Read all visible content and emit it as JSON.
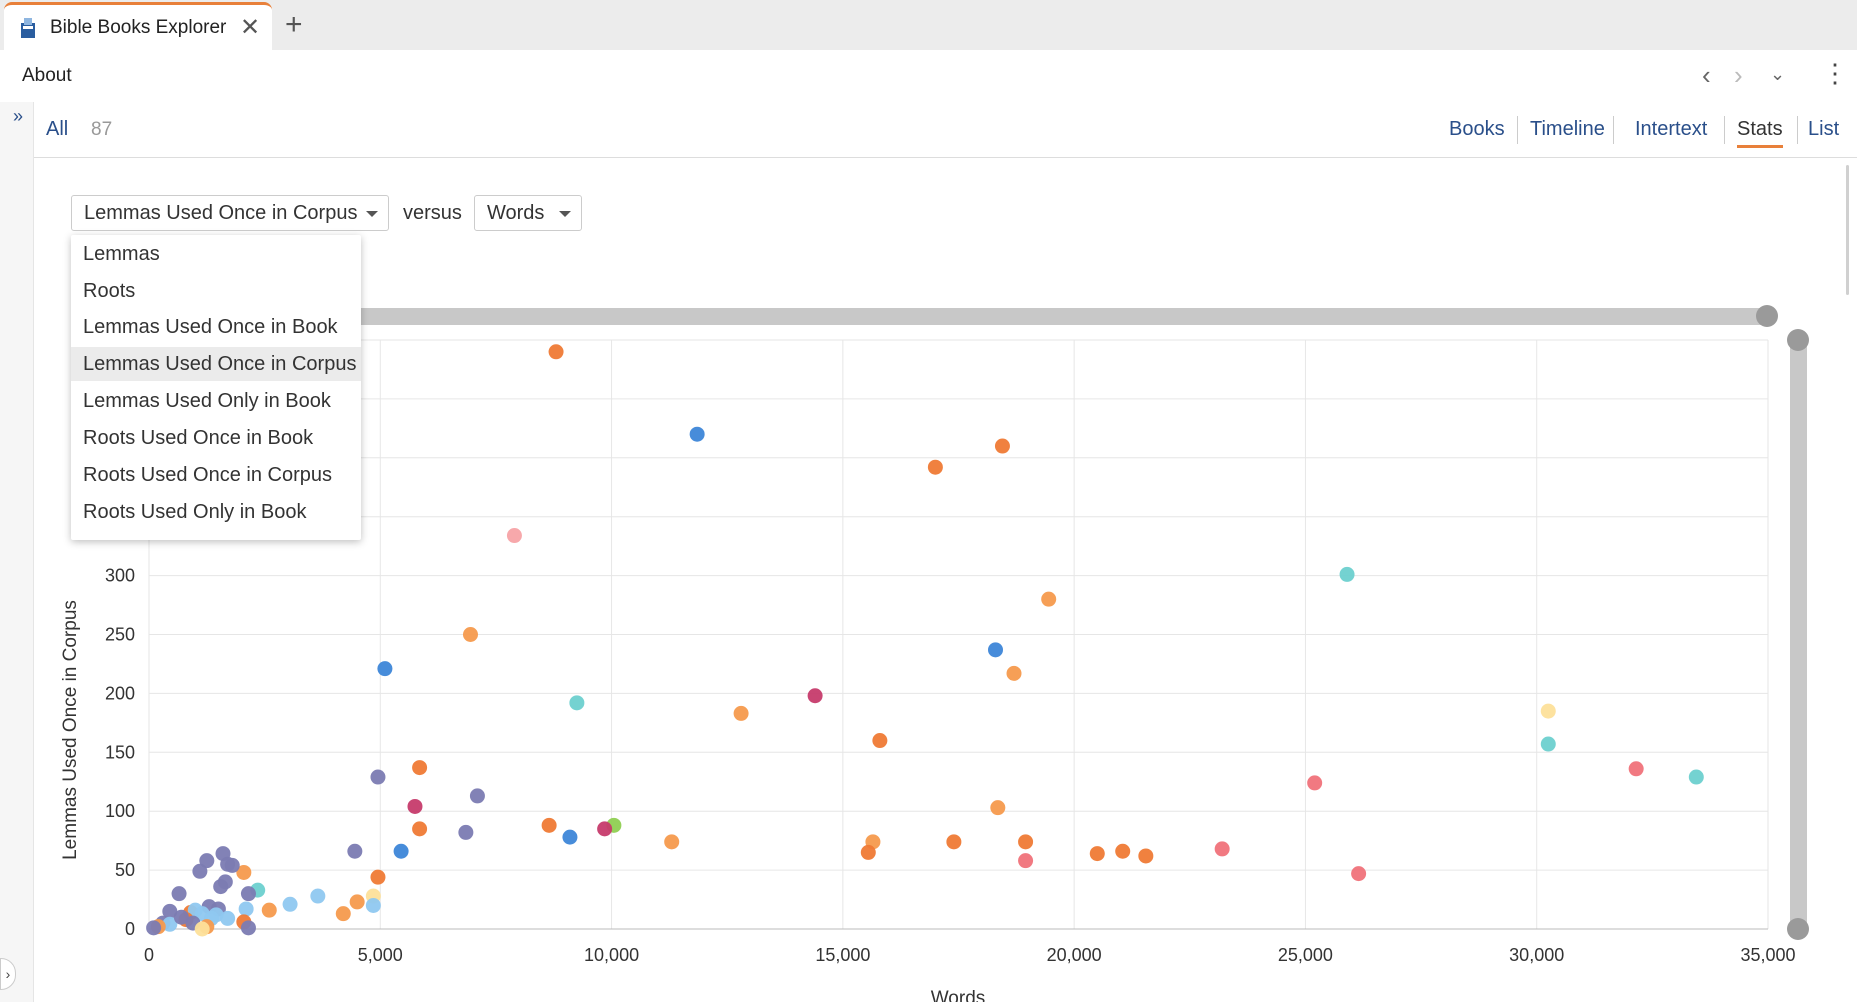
{
  "app": {
    "tab_title": "Bible Books Explorer",
    "tab_close": "✕",
    "new_tab": "+"
  },
  "toolbar": {
    "about_label": "About",
    "back": "‹",
    "forward": "›",
    "menu_down": "⌄",
    "more": "⋮"
  },
  "rail": {
    "expand": "»",
    "collapse": "›"
  },
  "filter": {
    "all_label": "All",
    "count": "87",
    "tabs": [
      "Books",
      "Timeline",
      "Intertext",
      "Stats",
      "List"
    ],
    "active_tab": "Stats"
  },
  "controls": {
    "y_select": "Lemmas Used Once in Corpus",
    "versus": "versus",
    "x_select": "Words",
    "y_options": [
      "Lemmas",
      "Roots",
      "Lemmas Used Once in Book",
      "Lemmas Used Once in Corpus",
      "Lemmas Used Only in Book",
      "Roots Used Once in Book",
      "Roots Used Once in Corpus",
      "Roots Used Only in Book"
    ]
  },
  "colors": {
    "accent": "#e8803a",
    "link": "#2a4f8a",
    "slider": "#c8c8c8",
    "knob": "#9a9a9a"
  },
  "chart_data": {
    "type": "scatter",
    "xlabel": "Words",
    "ylabel": "Lemmas Used Once in Corpus",
    "xlim": [
      0,
      35000
    ],
    "ylim": [
      0,
      500
    ],
    "x_ticks": [
      "0",
      "5,000",
      "10,000",
      "15,000",
      "20,000",
      "25,000",
      "30,000",
      "35,000"
    ],
    "y_ticks": [
      "0",
      "50",
      "100",
      "150",
      "200",
      "250",
      "300"
    ],
    "grid": true,
    "points": [
      {
        "x": 8800,
        "y": 490,
        "c": "#ef7a35"
      },
      {
        "x": 11850,
        "y": 420,
        "c": "#3d86d8"
      },
      {
        "x": 17000,
        "y": 392,
        "c": "#ef7a35"
      },
      {
        "x": 18450,
        "y": 410,
        "c": "#ef7a35"
      },
      {
        "x": 7900,
        "y": 334,
        "c": "#f7a3a6"
      },
      {
        "x": 25900,
        "y": 301,
        "c": "#6dd0cf"
      },
      {
        "x": 19450,
        "y": 280,
        "c": "#f59a4d"
      },
      {
        "x": 6950,
        "y": 250,
        "c": "#f59a4d"
      },
      {
        "x": 18300,
        "y": 237,
        "c": "#3d86d8"
      },
      {
        "x": 5100,
        "y": 221,
        "c": "#3d86d8"
      },
      {
        "x": 18700,
        "y": 217,
        "c": "#f59a4d"
      },
      {
        "x": 9250,
        "y": 192,
        "c": "#6dd0cf"
      },
      {
        "x": 14400,
        "y": 198,
        "c": "#c63b6c"
      },
      {
        "x": 12800,
        "y": 183,
        "c": "#f59a4d"
      },
      {
        "x": 30250,
        "y": 185,
        "c": "#fde09a"
      },
      {
        "x": 15800,
        "y": 160,
        "c": "#ef7a35"
      },
      {
        "x": 30250,
        "y": 157,
        "c": "#6dd0cf"
      },
      {
        "x": 5850,
        "y": 137,
        "c": "#ef7a35"
      },
      {
        "x": 32150,
        "y": 136,
        "c": "#f0727a"
      },
      {
        "x": 33450,
        "y": 129,
        "c": "#6dd0cf"
      },
      {
        "x": 4950,
        "y": 129,
        "c": "#7b7bb2"
      },
      {
        "x": 25200,
        "y": 124,
        "c": "#f0727a"
      },
      {
        "x": 7100,
        "y": 113,
        "c": "#7b7bb2"
      },
      {
        "x": 5750,
        "y": 104,
        "c": "#c63b6c"
      },
      {
        "x": 18350,
        "y": 103,
        "c": "#f59a4d"
      },
      {
        "x": 8650,
        "y": 88,
        "c": "#ef7a35"
      },
      {
        "x": 10050,
        "y": 88,
        "c": "#8fcf52"
      },
      {
        "x": 5850,
        "y": 85,
        "c": "#ef7a35"
      },
      {
        "x": 9850,
        "y": 85,
        "c": "#c63b6c"
      },
      {
        "x": 6850,
        "y": 82,
        "c": "#7b7bb2"
      },
      {
        "x": 9100,
        "y": 78,
        "c": "#3d86d8"
      },
      {
        "x": 11300,
        "y": 74,
        "c": "#f59a4d"
      },
      {
        "x": 15650,
        "y": 74,
        "c": "#f59a4d"
      },
      {
        "x": 17400,
        "y": 74,
        "c": "#ef7a35"
      },
      {
        "x": 18950,
        "y": 74,
        "c": "#ef7a35"
      },
      {
        "x": 15550,
        "y": 65,
        "c": "#ef7a35"
      },
      {
        "x": 20500,
        "y": 64,
        "c": "#ef7a35"
      },
      {
        "x": 21050,
        "y": 66,
        "c": "#ef7a35"
      },
      {
        "x": 21550,
        "y": 62,
        "c": "#ef7a35"
      },
      {
        "x": 23200,
        "y": 68,
        "c": "#f0727a"
      },
      {
        "x": 18950,
        "y": 58,
        "c": "#f0727a"
      },
      {
        "x": 26150,
        "y": 47,
        "c": "#f0727a"
      },
      {
        "x": 4450,
        "y": 66,
        "c": "#7b7bb2"
      },
      {
        "x": 5450,
        "y": 66,
        "c": "#3d86d8"
      },
      {
        "x": 4950,
        "y": 44,
        "c": "#ef7a35"
      },
      {
        "x": 4850,
        "y": 28,
        "c": "#fde09a"
      },
      {
        "x": 4500,
        "y": 23,
        "c": "#f59a4d"
      },
      {
        "x": 4850,
        "y": 20,
        "c": "#8fc8f0"
      },
      {
        "x": 4200,
        "y": 13,
        "c": "#f59a4d"
      },
      {
        "x": 3650,
        "y": 28,
        "c": "#8fc8f0"
      },
      {
        "x": 3050,
        "y": 21,
        "c": "#8fc8f0"
      },
      {
        "x": 2600,
        "y": 16,
        "c": "#f59a4d"
      },
      {
        "x": 2350,
        "y": 33,
        "c": "#6dd0cf"
      },
      {
        "x": 2150,
        "y": 30,
        "c": "#7b7bb2"
      },
      {
        "x": 2050,
        "y": 48,
        "c": "#f59a4d"
      },
      {
        "x": 1600,
        "y": 64,
        "c": "#7b7bb2"
      },
      {
        "x": 1700,
        "y": 55,
        "c": "#7b7bb2"
      },
      {
        "x": 1800,
        "y": 54,
        "c": "#7b7bb2"
      },
      {
        "x": 1250,
        "y": 58,
        "c": "#7b7bb2"
      },
      {
        "x": 1100,
        "y": 49,
        "c": "#7b7bb2"
      },
      {
        "x": 1650,
        "y": 40,
        "c": "#7b7bb2"
      },
      {
        "x": 1550,
        "y": 36,
        "c": "#7b7bb2"
      },
      {
        "x": 650,
        "y": 30,
        "c": "#7b7bb2"
      },
      {
        "x": 1300,
        "y": 19,
        "c": "#7b7bb2"
      },
      {
        "x": 1500,
        "y": 17,
        "c": "#7b7bb2"
      },
      {
        "x": 450,
        "y": 15,
        "c": "#7b7bb2"
      },
      {
        "x": 900,
        "y": 14,
        "c": "#ef7a35"
      },
      {
        "x": 1000,
        "y": 16,
        "c": "#8fc8f0"
      },
      {
        "x": 1150,
        "y": 13,
        "c": "#8fc8f0"
      },
      {
        "x": 1450,
        "y": 12,
        "c": "#8fc8f0"
      },
      {
        "x": 2100,
        "y": 17,
        "c": "#8fc8f0"
      },
      {
        "x": 800,
        "y": 8,
        "c": "#ef7a35"
      },
      {
        "x": 2050,
        "y": 6,
        "c": "#ef7a35"
      },
      {
        "x": 1350,
        "y": 9,
        "c": "#8fc8f0"
      },
      {
        "x": 300,
        "y": 5,
        "c": "#7b7bb2"
      },
      {
        "x": 950,
        "y": 5,
        "c": "#7b7bb2"
      },
      {
        "x": 450,
        "y": 4,
        "c": "#8fc8f0"
      },
      {
        "x": 2150,
        "y": 1,
        "c": "#7b7bb2"
      },
      {
        "x": 1250,
        "y": 2,
        "c": "#f59a4d"
      },
      {
        "x": 200,
        "y": 2,
        "c": "#f59a4d"
      },
      {
        "x": 100,
        "y": 1,
        "c": "#7b7bb2"
      },
      {
        "x": 1150,
        "y": 0,
        "c": "#fde09a"
      },
      {
        "x": 700,
        "y": 10,
        "c": "#7b7bb2"
      },
      {
        "x": 1700,
        "y": 9,
        "c": "#8fc8f0"
      }
    ]
  }
}
